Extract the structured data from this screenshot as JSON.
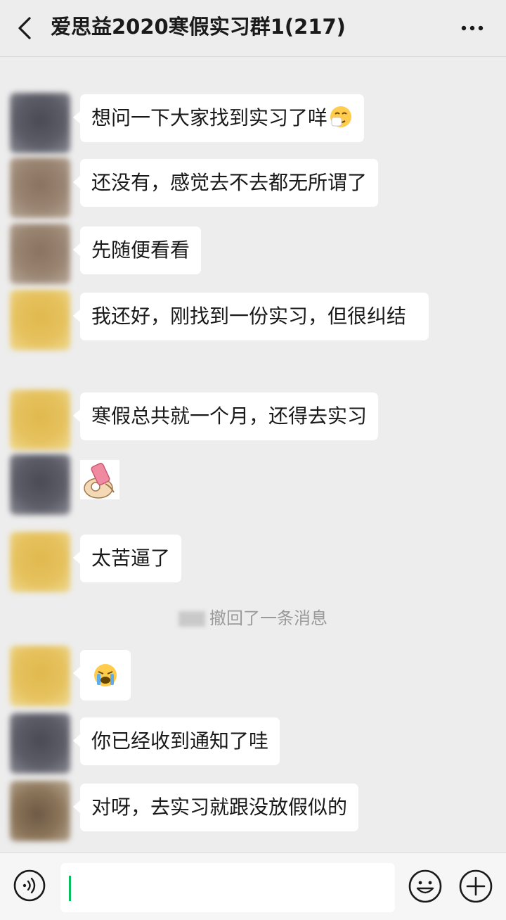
{
  "header": {
    "title": "爱思益2020寒假实习群1(217)",
    "back_icon": "chevron-left-icon",
    "more_icon": "more-dots-icon"
  },
  "messages": [
    {
      "text": "想问一下大家找到实习了咩",
      "emoji": "sneezing-face-emoji"
    },
    {
      "text": "还没有，感觉去不去都无所谓了"
    },
    {
      "text": "先随便看看"
    },
    {
      "text": "我还好，刚找到一份实习，但很纠结"
    },
    {
      "text": "寒假总共就一个月，还得去实习"
    },
    {
      "sticker": "phone-sticker"
    },
    {
      "text": "太苦逼了"
    },
    {
      "emoji": "loudly-crying-face-emoji"
    },
    {
      "text": "你已经收到通知了哇"
    },
    {
      "text": "对呀，去实习就跟没放假似的"
    }
  ],
  "system_message": {
    "text": "撤回了一条消息"
  },
  "input_bar": {
    "voice_icon": "voice-input-icon",
    "emoji_icon": "emoji-icon",
    "plus_icon": "plus-icon",
    "accent": "#07c160"
  }
}
